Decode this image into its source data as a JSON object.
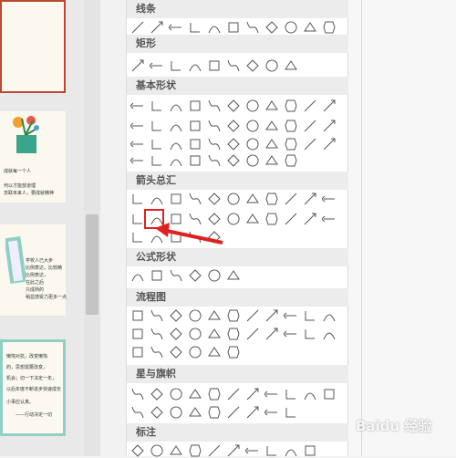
{
  "categories": [
    {
      "id": "lines",
      "label": "线条",
      "count": 11
    },
    {
      "id": "rect",
      "label": "矩形",
      "count": 9
    },
    {
      "id": "basic",
      "label": "基本形状",
      "count": 42
    },
    {
      "id": "arrows",
      "label": "箭头总汇",
      "count": 27
    },
    {
      "id": "formula",
      "label": "公式形状",
      "count": 6
    },
    {
      "id": "flow",
      "label": "流程图",
      "count": 28
    },
    {
      "id": "stars",
      "label": "星与旗帜",
      "count": 20
    },
    {
      "id": "callouts",
      "label": "标注",
      "count": 10
    }
  ],
  "slides": [
    {
      "lines": [
        "成就每一个人",
        "",
        "何以才能放道理",
        "苏联未来人，要成就精神"
      ]
    },
    {
      "lines": [
        "学校人已大步",
        "比例表达，比较精",
        "比例表达，",
        "在此之后",
        "只成熟的",
        "稍显感受力更多一点"
      ]
    },
    {
      "lines": [
        "懒惰对抗，改变懒惰",
        "的，思想需要改变，",
        "机会；切一下决定一年，",
        "以后年度不断进步快速成长",
        "小事应认真。",
        "——行动决定一切"
      ]
    }
  ],
  "selected_shape": "curved-arrow-down-shape",
  "colors": {
    "accent": "#e02020",
    "slide_border": "#b84a2f"
  },
  "watermark": "Baidu 经验"
}
